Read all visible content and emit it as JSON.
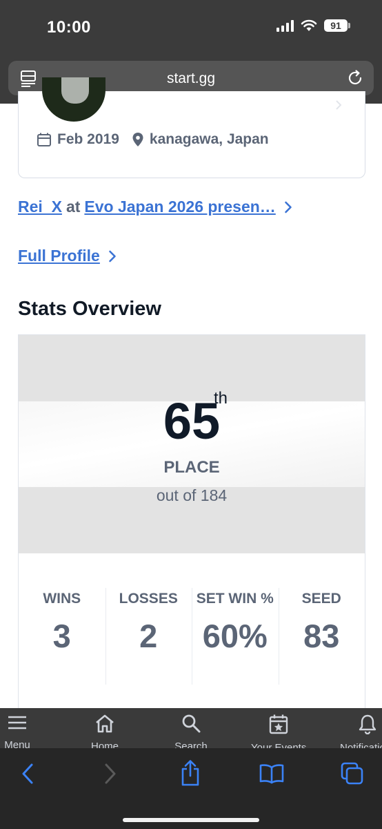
{
  "status_bar": {
    "time": "10:00",
    "battery": "91"
  },
  "browser": {
    "url": "start.gg"
  },
  "profile_card": {
    "date": "Feb 2019",
    "location": "kanagawa, Japan"
  },
  "links": {
    "event_player": "Rei_X",
    "event_at": "at",
    "event_name": "Evo Japan 2026 presen…",
    "full_profile": "Full Profile"
  },
  "stats_overview": {
    "title": "Stats Overview",
    "place": "65",
    "place_suffix": "th",
    "place_label": "PLACE",
    "out_of": "out of 184",
    "stats": [
      {
        "label": "WINS",
        "value": "3"
      },
      {
        "label": "LOSSES",
        "value": "2"
      },
      {
        "label": "SET WIN %",
        "value": "60%"
      },
      {
        "label": "SEED",
        "value": "83"
      }
    ]
  },
  "site_nav": {
    "items": [
      {
        "label": "Menu",
        "icon": "menu-icon"
      },
      {
        "label": "Home",
        "icon": "home-icon"
      },
      {
        "label": "Search",
        "icon": "search-icon"
      },
      {
        "label": "Your Events",
        "icon": "calendar-star-icon"
      },
      {
        "label": "Notifications",
        "icon": "bell-icon"
      }
    ]
  },
  "colors": {
    "link": "#3b73d4",
    "muted_text": "#5b6576",
    "heading": "#111a26",
    "toolbar_accent": "#3b82f6"
  }
}
